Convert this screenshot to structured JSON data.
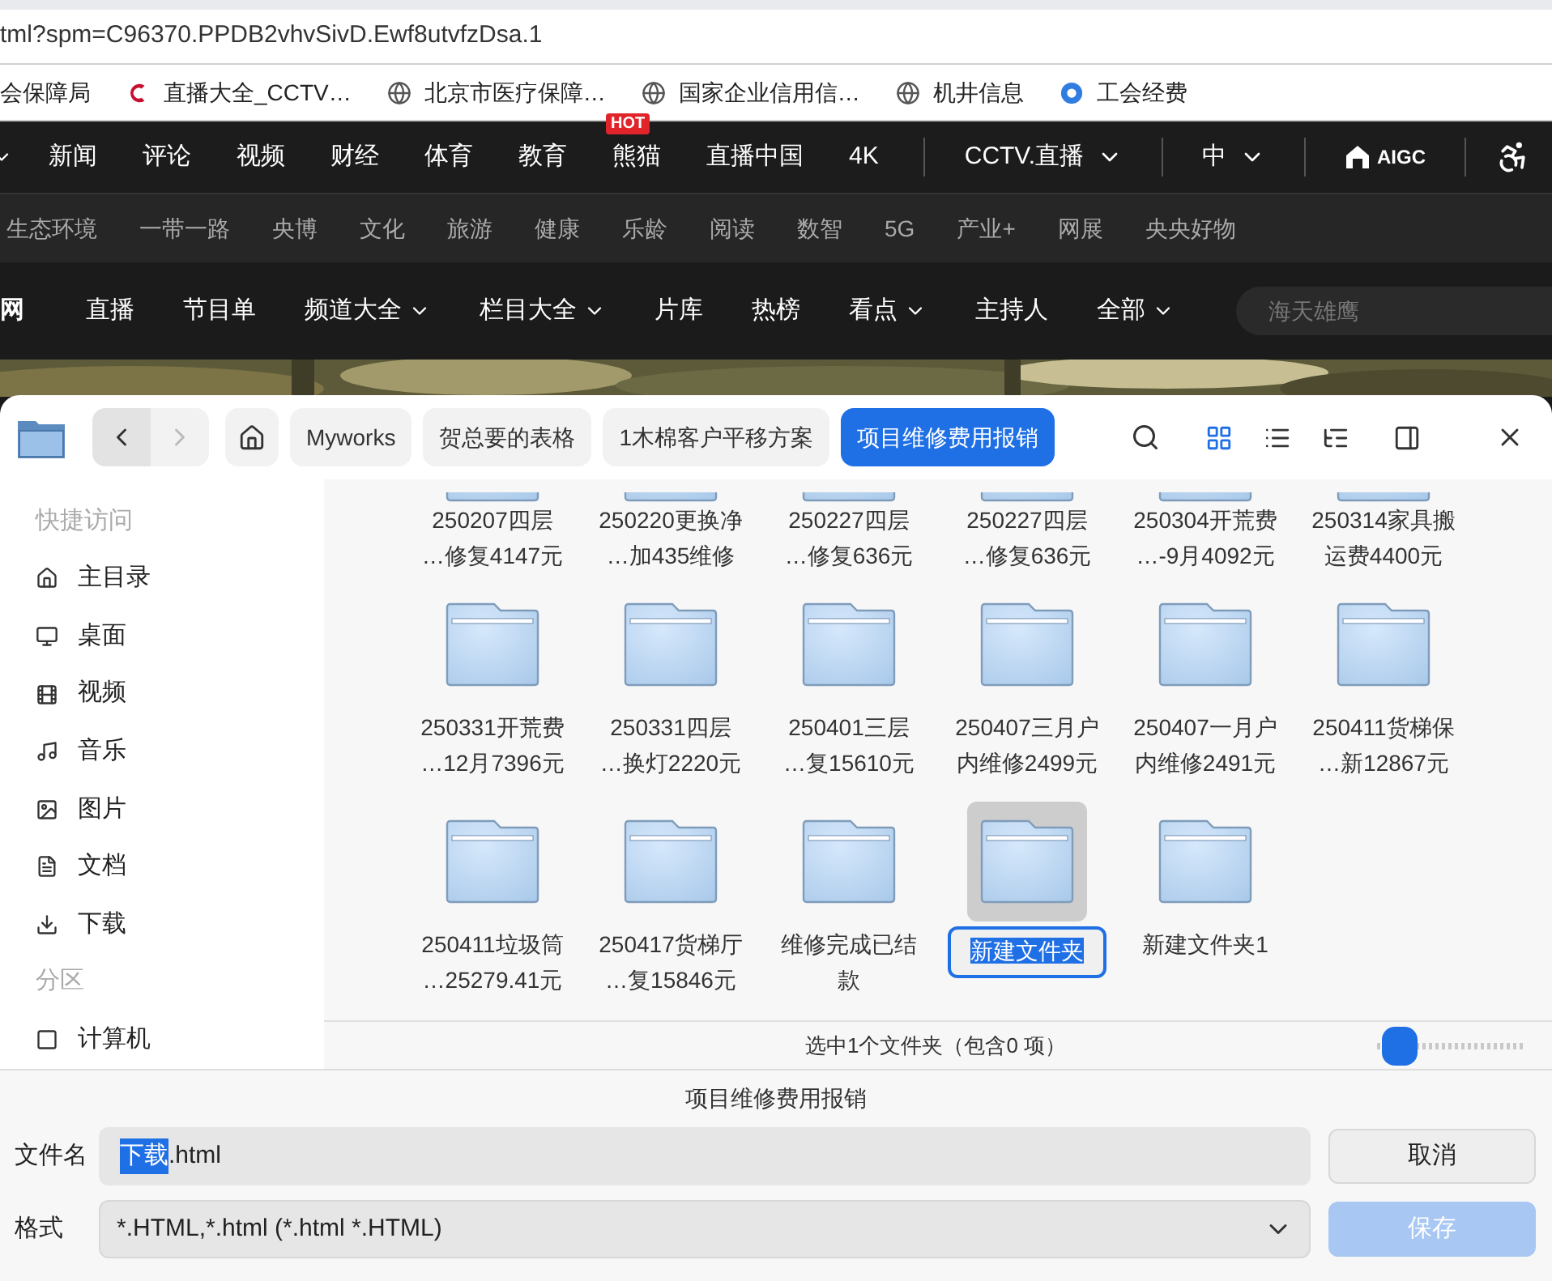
{
  "browser": {
    "address": "tml?spm=C96370.PPDB2vhvSivD.Ewf8utvfzDsa.1",
    "bookmarks": [
      {
        "label": "会保障局"
      },
      {
        "label": "直播大全_CCTV…"
      },
      {
        "label": "北京市医疗保障…"
      },
      {
        "label": "国家企业信用信…"
      },
      {
        "label": "机井信息"
      },
      {
        "label": "工会经费"
      }
    ]
  },
  "site": {
    "main_nav": [
      {
        "label": "新闻"
      },
      {
        "label": "评论"
      },
      {
        "label": "视频"
      },
      {
        "label": "财经"
      },
      {
        "label": "体育"
      },
      {
        "label": "教育"
      },
      {
        "label": "熊猫",
        "badge": "HOT"
      },
      {
        "label": "直播中国"
      },
      {
        "label": "4K"
      }
    ],
    "live_menu": "CCTV.直播",
    "language_menu": "中",
    "aigc_logo": "AIGC",
    "sub_nav": [
      "生态环境",
      "一带一路",
      "央博",
      "文化",
      "旅游",
      "健康",
      "乐龄",
      "阅读",
      "数智",
      "5G",
      "产业+",
      "网展",
      "央央好物"
    ],
    "brand_fragment": "网",
    "channel_nav": [
      {
        "label": "直播",
        "has_menu": false
      },
      {
        "label": "节目单",
        "has_menu": false
      },
      {
        "label": "频道大全",
        "has_menu": true
      },
      {
        "label": "栏目大全",
        "has_menu": true
      },
      {
        "label": "片库",
        "has_menu": false
      },
      {
        "label": "热榜",
        "has_menu": false
      },
      {
        "label": "看点",
        "has_menu": true
      },
      {
        "label": "主持人",
        "has_menu": false
      },
      {
        "label": "全部",
        "has_menu": true
      }
    ],
    "search": {
      "placeholder": "海天雄鹰"
    }
  },
  "dialog": {
    "back_enabled": true,
    "forward_enabled": false,
    "breadcrumbs": [
      {
        "label": "Myworks",
        "selected": false
      },
      {
        "label": "贺总要的表格",
        "selected": false
      },
      {
        "label": "1木棉客户平移方案",
        "selected": false
      },
      {
        "label": "项目维修费用报销",
        "selected": true
      }
    ],
    "views": [
      {
        "kind": "grid",
        "selected": true
      },
      {
        "kind": "list",
        "selected": false
      },
      {
        "kind": "tree",
        "selected": false
      }
    ],
    "sidebar": [
      {
        "kind": "header",
        "label": "快捷访问"
      },
      {
        "kind": "item",
        "label": "主目录"
      },
      {
        "kind": "item",
        "label": "桌面"
      },
      {
        "kind": "item",
        "label": "视频"
      },
      {
        "kind": "item",
        "label": "音乐"
      },
      {
        "kind": "item",
        "label": "图片"
      },
      {
        "kind": "item",
        "label": "文档"
      },
      {
        "kind": "item",
        "label": "下载"
      },
      {
        "kind": "header",
        "label": "分区"
      },
      {
        "kind": "item",
        "label": "计算机"
      }
    ],
    "partial_row": [
      {
        "lines": [
          "250207四层",
          "…修复4147元"
        ]
      },
      {
        "lines": [
          "250220更换净",
          "…加435维修"
        ]
      },
      {
        "lines": [
          "250227四层",
          "…修复636元"
        ]
      },
      {
        "lines": [
          "250227四层",
          "…修复636元"
        ]
      },
      {
        "lines": [
          "250304开荒费",
          "…-9月4092元"
        ]
      },
      {
        "lines": [
          "250314家具搬",
          "运费4400元"
        ]
      }
    ],
    "folders": [
      {
        "lines": [
          "250331开荒费",
          "…12月7396元"
        ],
        "selected": false,
        "editing": false
      },
      {
        "lines": [
          "250331四层",
          "…换灯2220元"
        ],
        "selected": false,
        "editing": false
      },
      {
        "lines": [
          "250401三层",
          "…复15610元"
        ],
        "selected": false,
        "editing": false
      },
      {
        "lines": [
          "250407三月户",
          "内维修2499元"
        ],
        "selected": false,
        "editing": false
      },
      {
        "lines": [
          "250407一月户",
          "内维修2491元"
        ],
        "selected": false,
        "editing": false
      },
      {
        "lines": [
          "250411货梯保",
          "…新12867元"
        ],
        "selected": false,
        "editing": false
      },
      {
        "lines": [
          "250411垃圾筒",
          "…25279.41元"
        ],
        "selected": false,
        "editing": false
      },
      {
        "lines": [
          "250417货梯厅",
          "…复15846元"
        ],
        "selected": false,
        "editing": false
      },
      {
        "lines": [
          "维修完成已结",
          "款"
        ],
        "selected": false,
        "editing": false
      },
      {
        "lines": [
          "新建文件夹"
        ],
        "selected": true,
        "editing": true
      },
      {
        "lines": [
          "新建文件夹1"
        ],
        "selected": false,
        "editing": false
      }
    ],
    "status": "选中1个文件夹（包含0 项）",
    "zoom": {
      "level": 0.05
    },
    "folder_title": "项目维修费用报销",
    "filename": {
      "label": "文件名",
      "selected_text": "下载",
      "rest_text": ".html"
    },
    "format": {
      "label": "格式",
      "value": "*.HTML,*.html (*.html *.HTML)"
    },
    "buttons": [
      {
        "label": "取消",
        "kind": "secondary",
        "disabled": false
      },
      {
        "label": "保存",
        "kind": "primary",
        "disabled": true
      }
    ]
  }
}
